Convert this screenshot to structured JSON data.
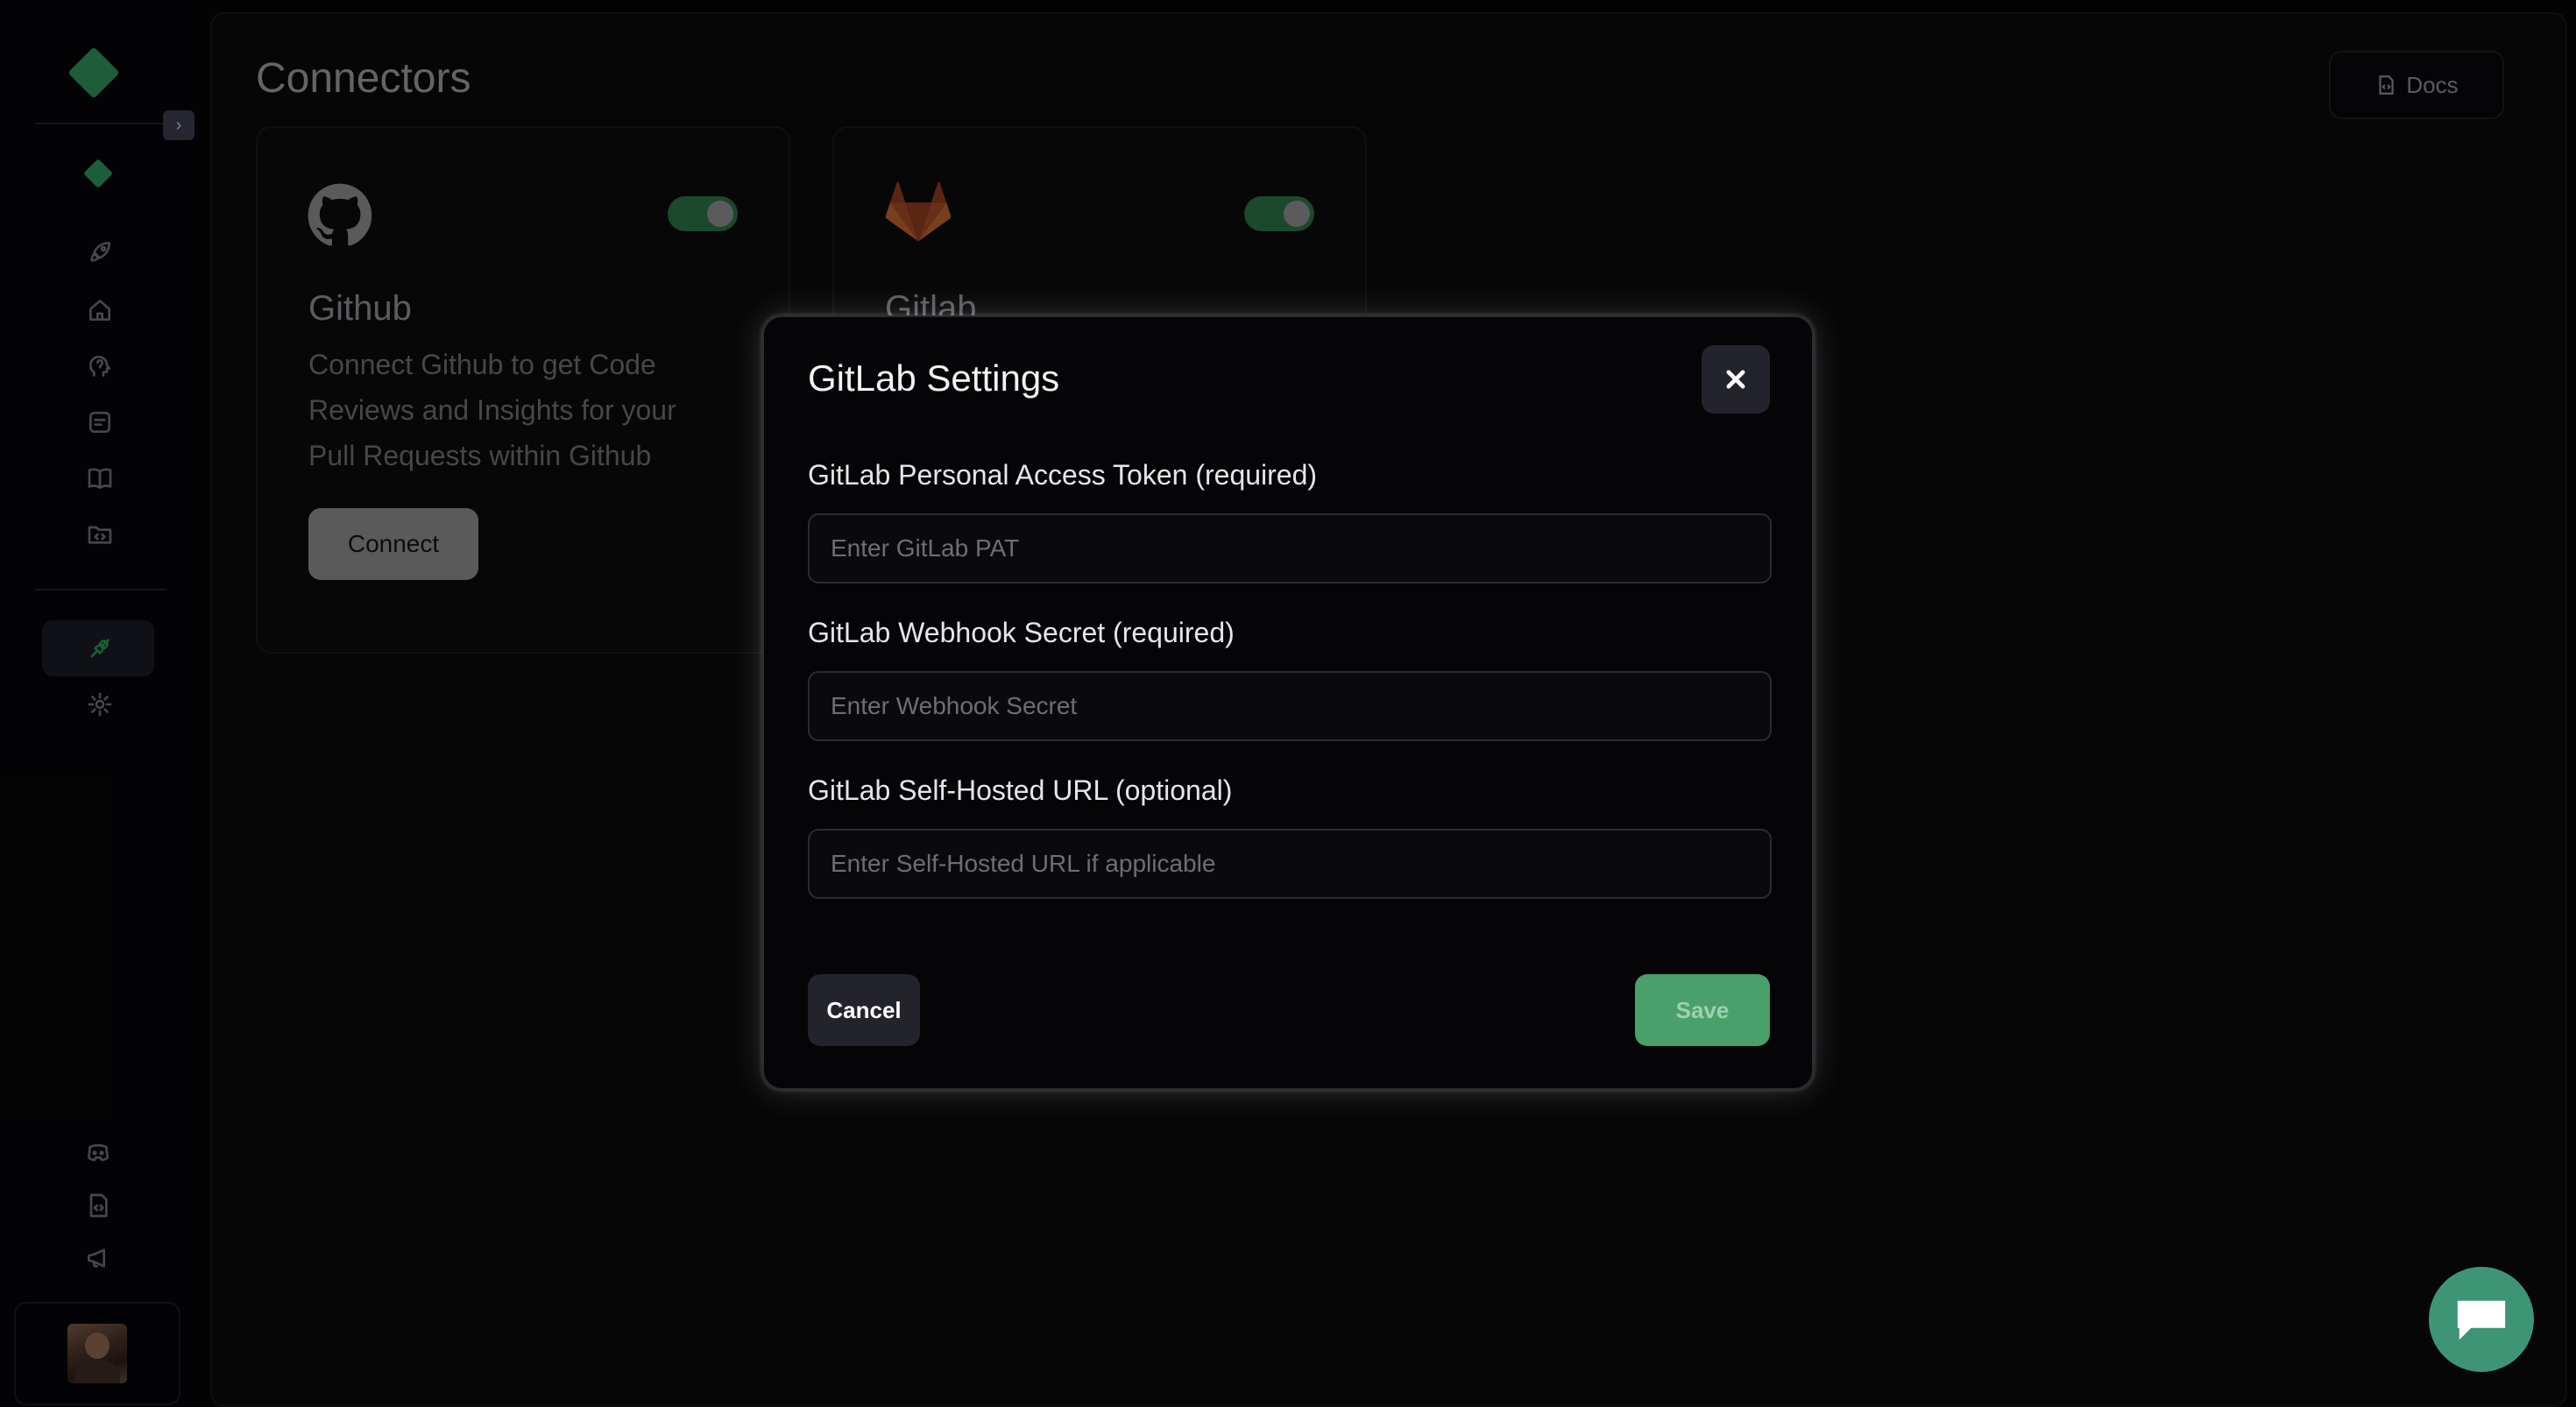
{
  "page": {
    "title": "Connectors",
    "docs_label": "Docs"
  },
  "sidebar": {
    "items": [
      {
        "icon": "rocket-icon"
      },
      {
        "icon": "home-icon"
      },
      {
        "icon": "brain-icon"
      },
      {
        "icon": "notes-icon"
      },
      {
        "icon": "book-icon"
      },
      {
        "icon": "code-folder-icon"
      },
      {
        "icon": "plug-icon",
        "active": true
      },
      {
        "icon": "gear-icon"
      }
    ],
    "bottom_items": [
      {
        "icon": "discord-icon"
      },
      {
        "icon": "docs-icon"
      },
      {
        "icon": "megaphone-icon"
      }
    ]
  },
  "connectors": [
    {
      "name": "Github",
      "description": "Connect Github to get Code Reviews and Insights for your Pull Requests within Github",
      "button_label": "Connect",
      "enabled": true
    },
    {
      "name": "Gitlab",
      "enabled": true
    }
  ],
  "modal": {
    "title": "GitLab Settings",
    "fields": [
      {
        "label": "GitLab Personal Access Token (required)",
        "placeholder": "Enter GitLab PAT",
        "value": ""
      },
      {
        "label": "GitLab Webhook Secret (required)",
        "placeholder": "Enter Webhook Secret",
        "value": ""
      },
      {
        "label": "GitLab Self-Hosted URL (optional)",
        "placeholder": "Enter Self-Hosted URL if applicable",
        "value": ""
      }
    ],
    "cancel_label": "Cancel",
    "save_label": "Save"
  },
  "colors": {
    "accent": "#2f8f5a",
    "save_button": "#4aa06a",
    "chat_button": "#3d9576",
    "toggle_on": "#2b6f44"
  }
}
